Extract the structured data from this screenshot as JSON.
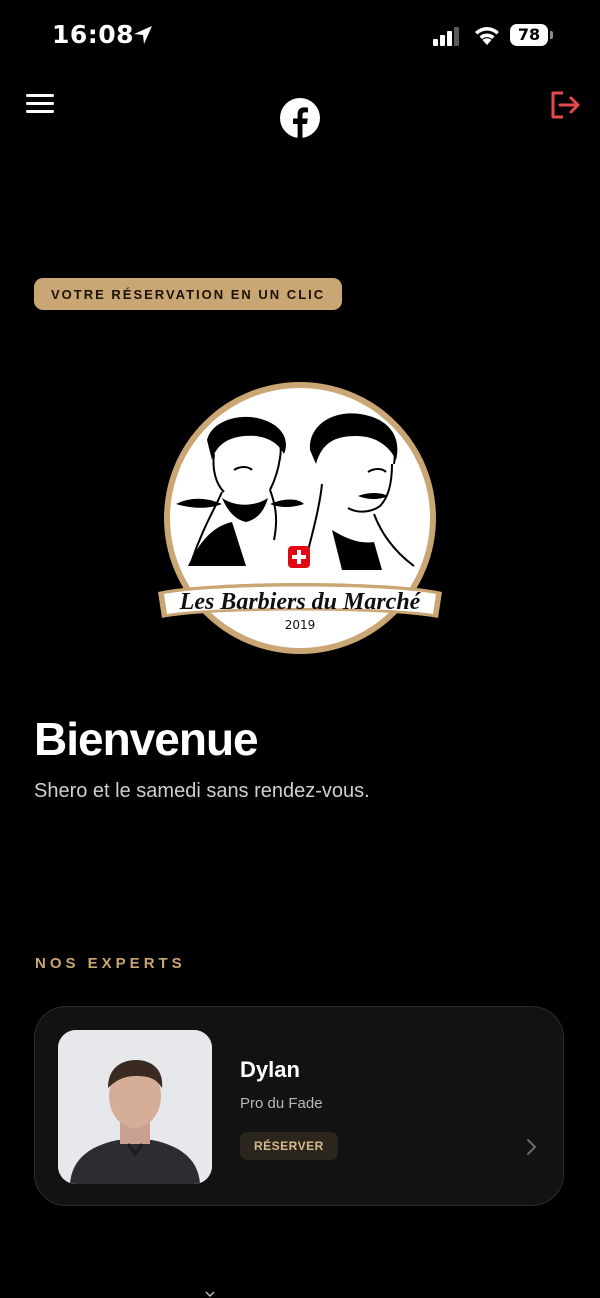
{
  "status_bar": {
    "time": "16:08",
    "battery": "78"
  },
  "pill": {
    "label": "VOTRE RÉSERVATION EN UN CLIC"
  },
  "logo": {
    "text": "Les Barbiers du Marché",
    "year": "2019"
  },
  "welcome": {
    "title": "Bienvenue",
    "subtitle": "Shero et le samedi sans rendez-vous."
  },
  "experts": {
    "section_label": "NOS EXPERTS",
    "items": [
      {
        "name": "Dylan",
        "role": "Pro du Fade",
        "button": "RÉSERVER"
      }
    ]
  },
  "colors": {
    "accent": "#c9a673",
    "logout": "#e5484d",
    "background": "#000000",
    "card": "#121212"
  },
  "icons": [
    "location-arrow-icon",
    "signal-icon",
    "wifi-icon",
    "battery-icon",
    "hamburger-menu-icon",
    "facebook-icon",
    "logout-icon",
    "chevron-right-icon"
  ]
}
